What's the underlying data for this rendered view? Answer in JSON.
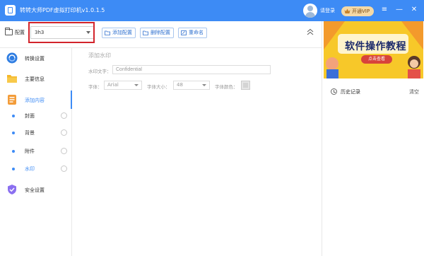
{
  "app": {
    "title": "转转大师PDF虚拟打印机v1.0.1.5",
    "login_text": "请登录",
    "vip_label": "开通VIP",
    "accent_color": "#3d8bf5"
  },
  "window_controls": {
    "menu_icon": "≡",
    "minimize_icon": "—",
    "close_icon": "✕"
  },
  "toolbar": {
    "config_label": "配置",
    "config_value": "3h3",
    "add_config_label": "添加配置",
    "delete_config_label": "删除配置",
    "rename_label": "重命名"
  },
  "sidebar": {
    "items": [
      {
        "label": "转换设置"
      },
      {
        "label": "主要信息"
      },
      {
        "label": "添加内容"
      },
      {
        "label": "安全设置"
      }
    ],
    "sub_items": [
      {
        "label": "封面"
      },
      {
        "label": "背景"
      },
      {
        "label": "附件"
      },
      {
        "label": "水印"
      }
    ]
  },
  "watermark": {
    "section_title": "添加水印",
    "text_label": "水印文字：",
    "text_value": "Confidential",
    "font_label": "字体：",
    "font_value": "Arial",
    "size_label": "字体大小：",
    "size_value": "48",
    "color_label": "字体颜色："
  },
  "right_panel": {
    "banner_title": "软件操作教程",
    "banner_subtitle": "点击查看",
    "history_label": "历史记录",
    "clear_label": "清空"
  }
}
